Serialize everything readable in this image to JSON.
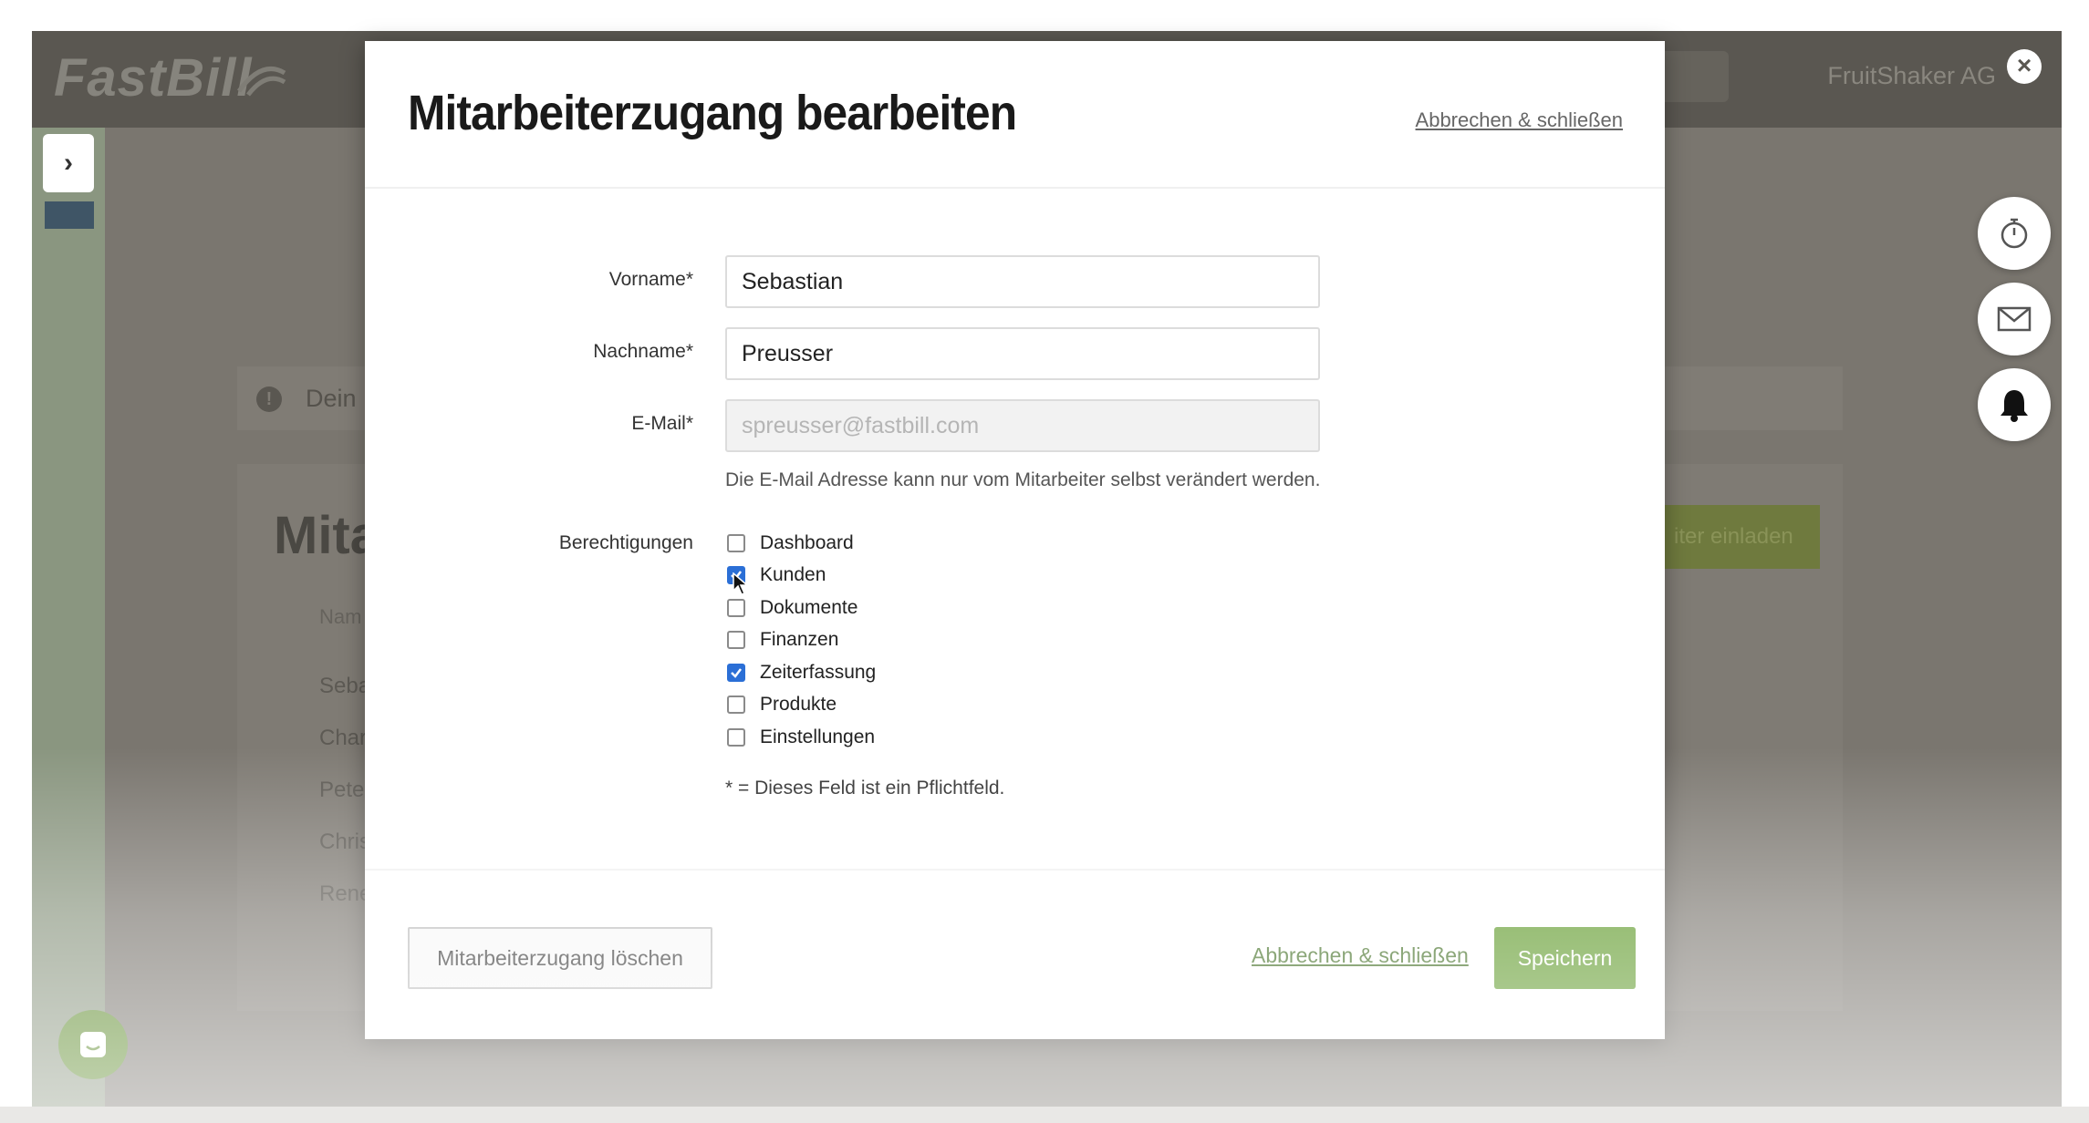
{
  "app": {
    "logo_text": "FastBill",
    "company_name": "FruitShaker AG",
    "notice_text": "Dein",
    "page_title_partial": "Mitar",
    "column_header_partial": "Nam",
    "invite_button_partial": "iter einladen",
    "rows_partial": [
      "Seba",
      "Char",
      "Pete",
      "Chris",
      "Rene"
    ]
  },
  "modal": {
    "title": "Mitarbeiterzugang bearbeiten",
    "header_cancel": "Abbrechen & schließen",
    "fields": {
      "first_name_label": "Vorname*",
      "first_name_value": "Sebastian",
      "last_name_label": "Nachname*",
      "last_name_value": "Preusser",
      "email_label": "E-Mail*",
      "email_placeholder": "spreusser@fastbill.com",
      "email_hint": "Die E-Mail Adresse kann nur vom Mitarbeiter selbst verändert werden."
    },
    "permissions_label": "Berechtigungen",
    "permissions": [
      {
        "label": "Dashboard",
        "checked": false
      },
      {
        "label": "Kunden",
        "checked": true
      },
      {
        "label": "Dokumente",
        "checked": false
      },
      {
        "label": "Finanzen",
        "checked": false
      },
      {
        "label": "Zeiterfassung",
        "checked": true
      },
      {
        "label": "Produkte",
        "checked": false
      },
      {
        "label": "Einstellungen",
        "checked": false
      }
    ],
    "required_note": "* = Dieses Feld ist ein Pflichtfeld.",
    "delete_button": "Mitarbeiterzugang löschen",
    "footer_cancel": "Abbrechen & schließen",
    "save_button": "Speichern"
  },
  "icons": {
    "close": "close-icon",
    "sidebar_toggle": "chevron-right-icon",
    "timer": "stopwatch-icon",
    "mail": "envelope-icon",
    "notifications": "bell-icon",
    "chat": "chat-icon"
  },
  "colors": {
    "accent_green": "#5f9a2a",
    "checkbox_blue": "#2b6fd6",
    "link_green": "#3d6b1e"
  }
}
